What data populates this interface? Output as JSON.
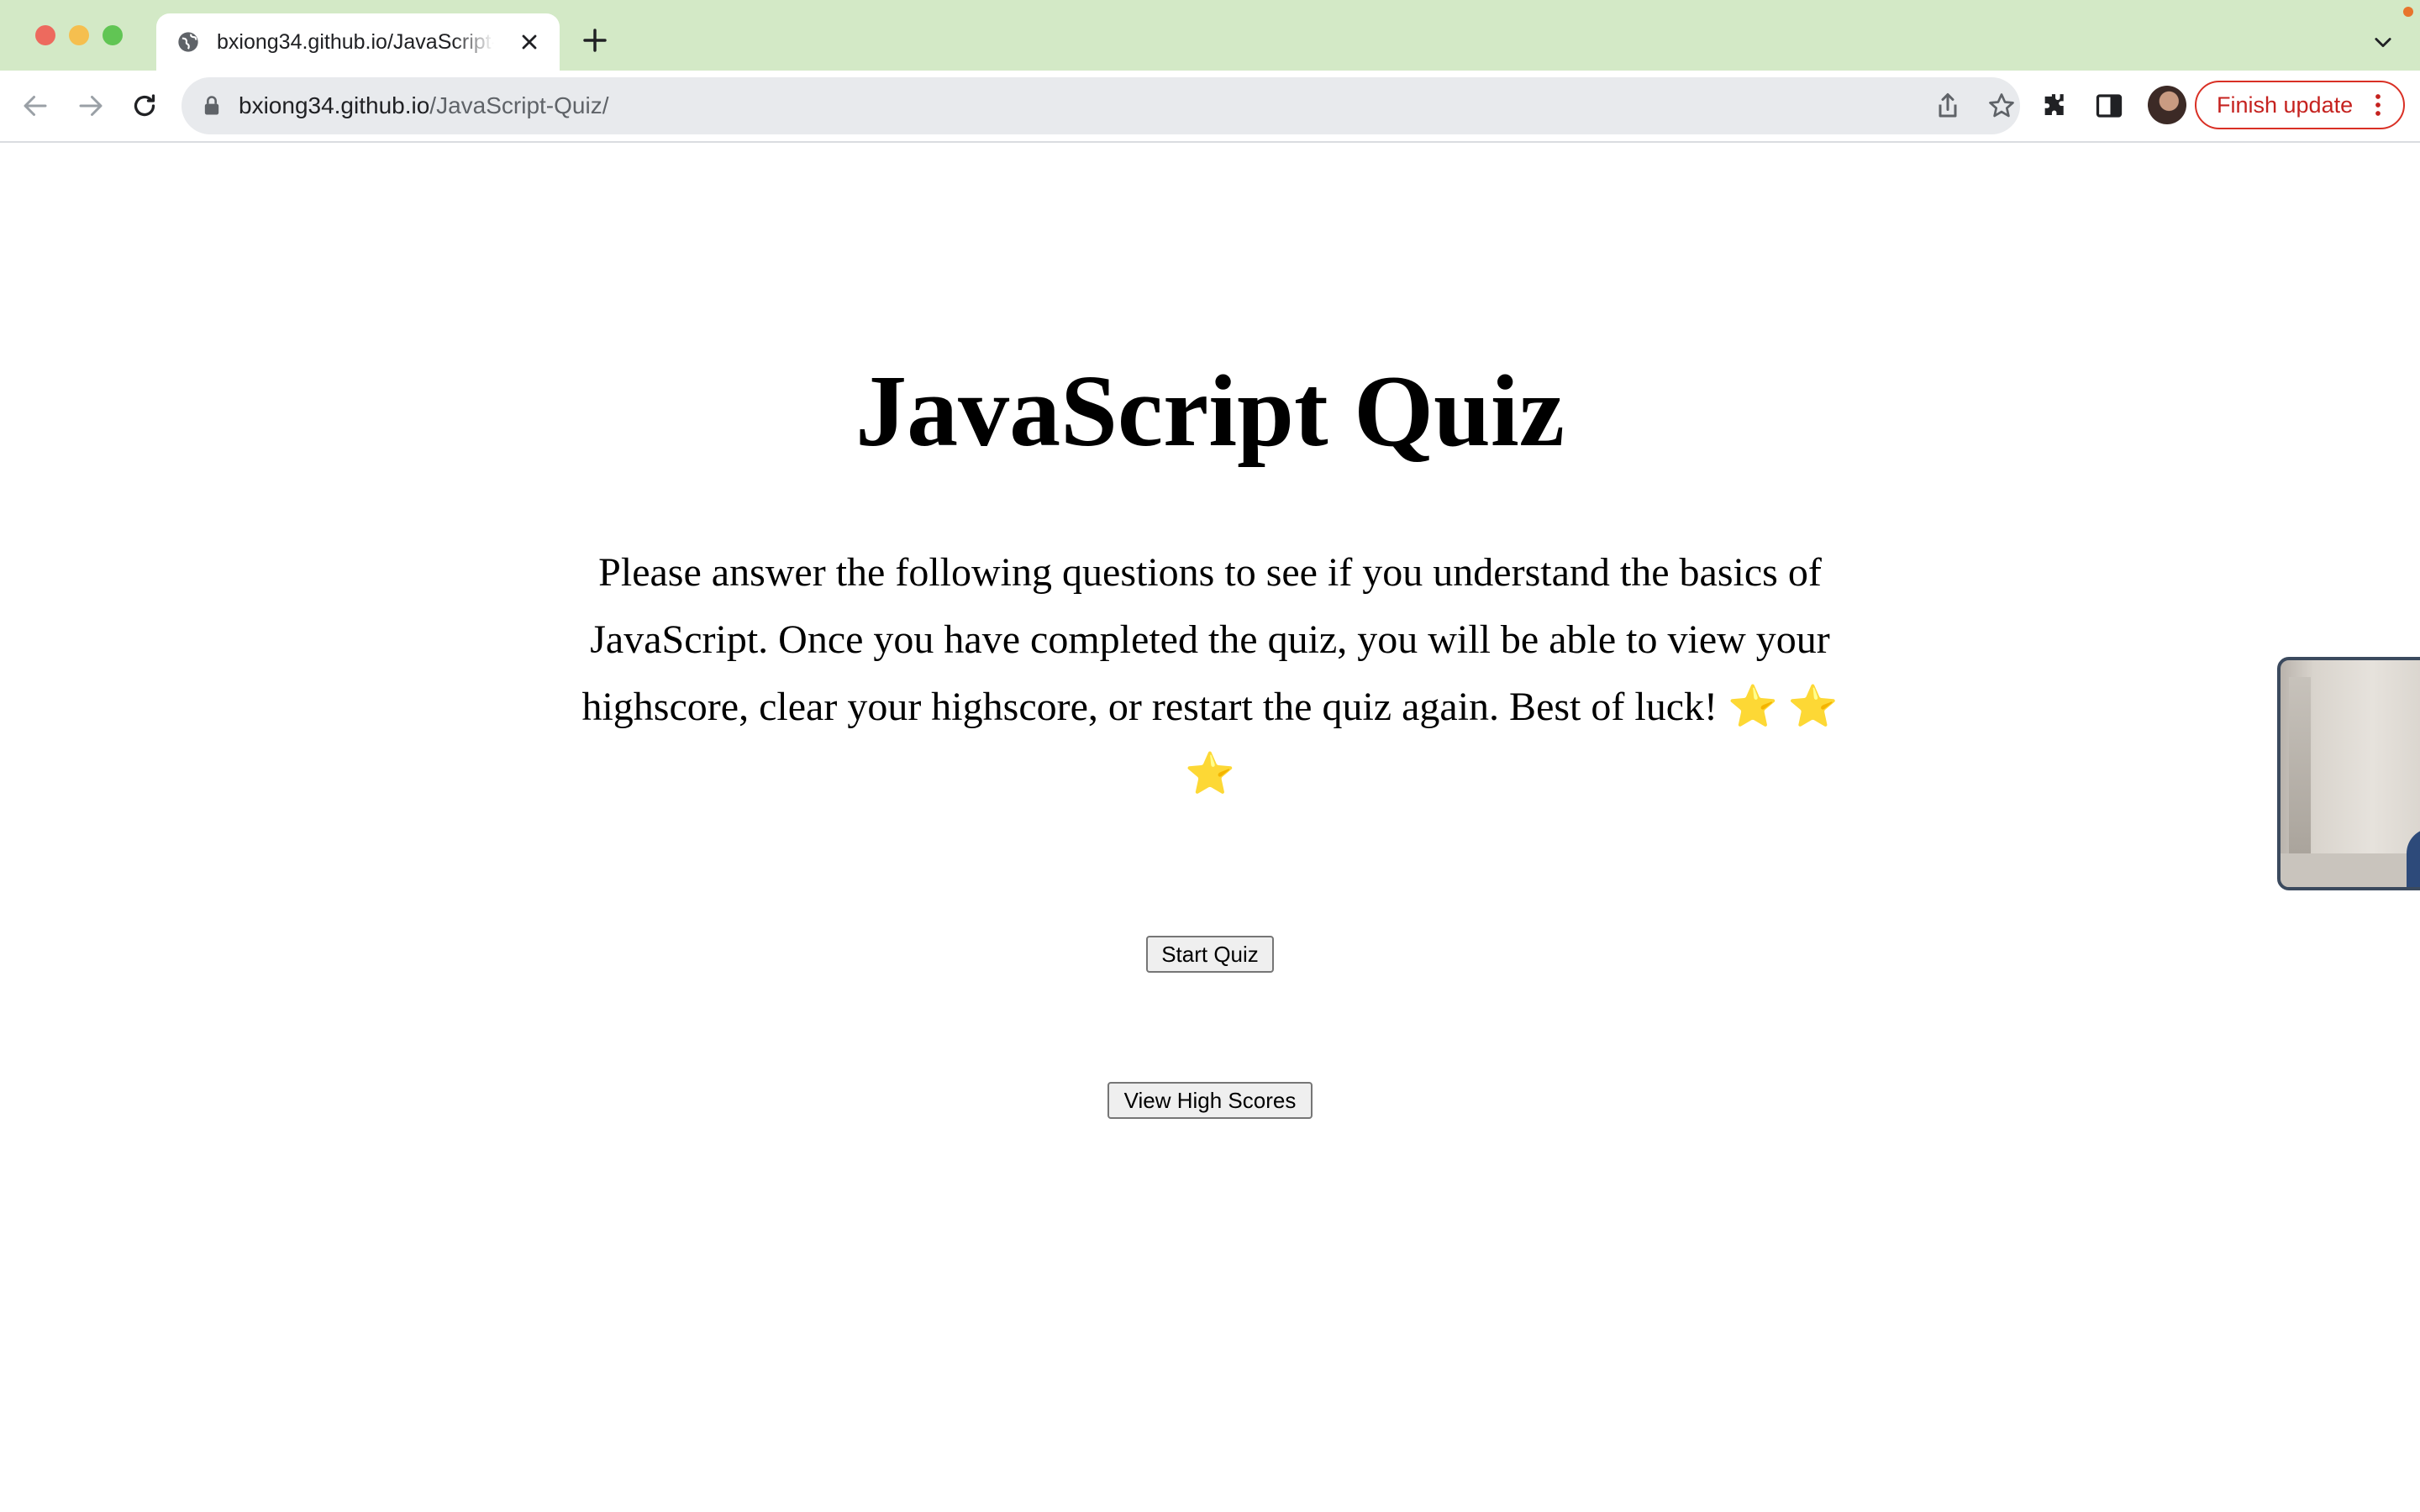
{
  "browser": {
    "tab": {
      "title": "bxiong34.github.io/JavaScript-Quiz/",
      "favicon": "globe-icon"
    },
    "address_bar": {
      "host": "bxiong34.github.io",
      "path": "/JavaScript-Quiz/"
    },
    "finish_update_label": "Finish update",
    "colors": {
      "tabstrip": "#d3e9c6",
      "finish_update": "#c5221f"
    }
  },
  "page": {
    "title": "JavaScript Quiz",
    "intro": "Please answer the following questions to see if you understand the basics of JavaScript. Once you have completed the quiz, you will be able to view your highscore, clear your highscore, or restart the quiz again. Best of luck! ⭐️ ⭐️ ⭐️",
    "start_button": "Start Quiz",
    "high_scores_button": "View High Scores"
  }
}
